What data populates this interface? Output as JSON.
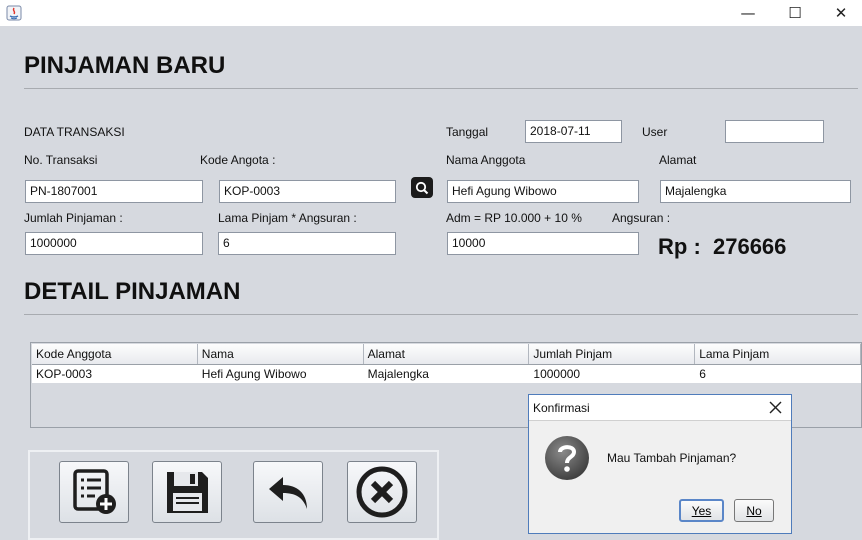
{
  "window": {
    "minimize_glyph": "—",
    "maximize_glyph": "☐",
    "close_glyph": "✕"
  },
  "header": {
    "title": "PINJAMAN BARU"
  },
  "form": {
    "section_label": "DATA TRANSAKSI",
    "tanggal_label": "Tanggal",
    "tanggal_value": "2018-07-11",
    "user_label": "User",
    "user_value": "",
    "no_transaksi_label": "No. Transaksi",
    "no_transaksi_value": "PN-1807001",
    "kode_angota_label": "Kode Angota  :",
    "kode_angota_value": "KOP-0003",
    "nama_anggota_label": "Nama Anggota",
    "nama_anggota_value": "Hefi Agung Wibowo",
    "alamat_label": "Alamat",
    "alamat_value": "Majalengka",
    "jumlah_label": "Jumlah Pinjaman :",
    "jumlah_value": "1000000",
    "lama_label": "Lama Pinjam * Angsuran :",
    "lama_value": "6",
    "adm_label": "Adm = RP 10.000 + 10 %",
    "adm_value": "10000",
    "angsuran_label": "Angsuran :",
    "angsuran_amount": "Rp :  276666"
  },
  "detail": {
    "title": "DETAIL PINJAMAN",
    "columns": [
      "Kode Anggota",
      "Nama",
      "Alamat",
      "Jumlah Pinjam",
      "Lama Pinjam"
    ],
    "rows": [
      [
        "KOP-0003",
        "Hefi Agung Wibowo",
        "Majalengka",
        "1000000",
        "6"
      ]
    ]
  },
  "toolbar": {
    "icons": [
      "add-record-icon",
      "save-floppy-icon",
      "undo-arrow-icon",
      "cancel-x-icon"
    ]
  },
  "dialog": {
    "title": "Konfirmasi",
    "message": "Mau Tambah Pinjaman?",
    "yes_label": "Yes",
    "no_label": "No"
  },
  "colors": {
    "background": "#d6d9df",
    "dialog_border": "#4f7cbb",
    "search_button": "#1b1b1b"
  }
}
